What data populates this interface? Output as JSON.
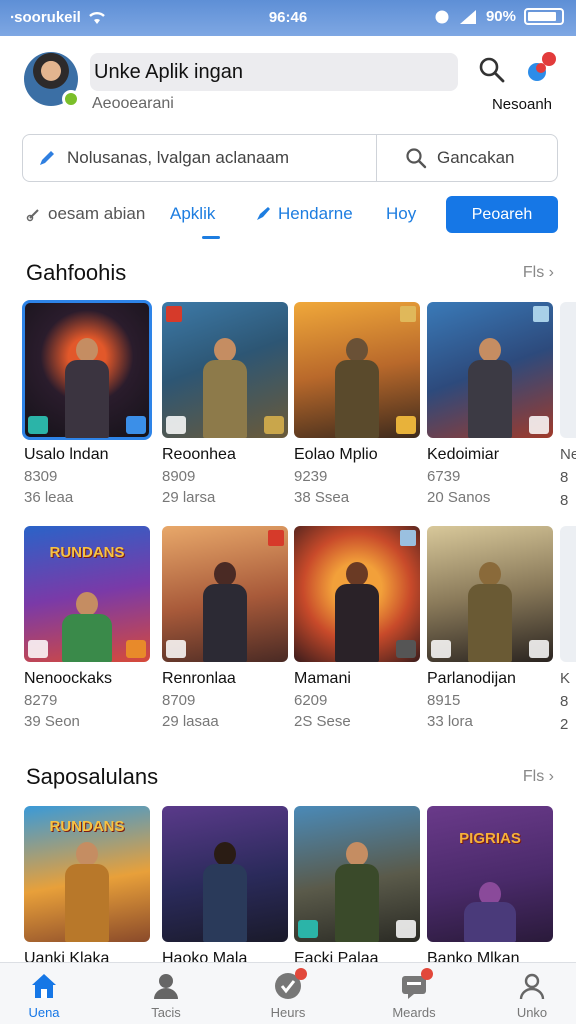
{
  "status_bar": {
    "carrier": "∙soorukeil",
    "time": "96:46",
    "battery": "90%"
  },
  "header": {
    "title": "Unke Aplik ingan",
    "subtitle": "Aeooearani",
    "user_label": "Nesoanh"
  },
  "search": {
    "placeholder": "Nolusanas, lvalgan aclanaam",
    "button_label": "Gancakan"
  },
  "tabs": [
    {
      "label": "oesam abian"
    },
    {
      "label": "Apklik"
    },
    {
      "label": "Hendarne"
    },
    {
      "label": "Hoy"
    }
  ],
  "tab_button": "Peoareh",
  "sections": [
    {
      "title": "Gahfoohis",
      "more": "Fls",
      "rows": [
        [
          {
            "name": "Usalo lndan",
            "meta1": "8309",
            "meta2": "36 leaa"
          },
          {
            "name": "Reoonhea",
            "meta1": "8909",
            "meta2": "29 larsa"
          },
          {
            "name": "Eolao Mplio",
            "meta1": "9239",
            "meta2": "38 Ssea"
          },
          {
            "name": "Kedoimiar",
            "meta1": "6739",
            "meta2": "20 Sanos"
          }
        ],
        [
          {
            "name": "Nenoockaks",
            "meta1": "8279",
            "meta2": "39 Seon",
            "logo": "RUNDANS"
          },
          {
            "name": "Renronlaa",
            "meta1": "8709",
            "meta2": "29 lasaa"
          },
          {
            "name": "Mamani",
            "meta1": "6209",
            "meta2": "2S Sese"
          },
          {
            "name": "Parlanodijan",
            "meta1": "8915",
            "meta2": "33 lora"
          }
        ]
      ],
      "peek_row1": {
        "name": "Ne",
        "meta1": "8",
        "meta2": "8"
      },
      "peek_row2": {
        "name": "K",
        "meta1": "8",
        "meta2": "2"
      }
    },
    {
      "title": "Saposalulans",
      "more": "Fls",
      "rows": [
        [
          {
            "name": "Uanki Klaka",
            "logo": "RUNDANS"
          },
          {
            "name": "Haoko Mala"
          },
          {
            "name": "Eacki Palaa"
          },
          {
            "name": "Banko Mlkan",
            "logo": "PIGRIAS"
          }
        ]
      ]
    }
  ],
  "bottom_nav": [
    {
      "label": "Uena"
    },
    {
      "label": "Tacis"
    },
    {
      "label": "Heurs"
    },
    {
      "label": "Meards"
    },
    {
      "label": "Unko"
    }
  ],
  "colors": {
    "accent": "#1677e6",
    "status_bar": "#6a98dc"
  }
}
